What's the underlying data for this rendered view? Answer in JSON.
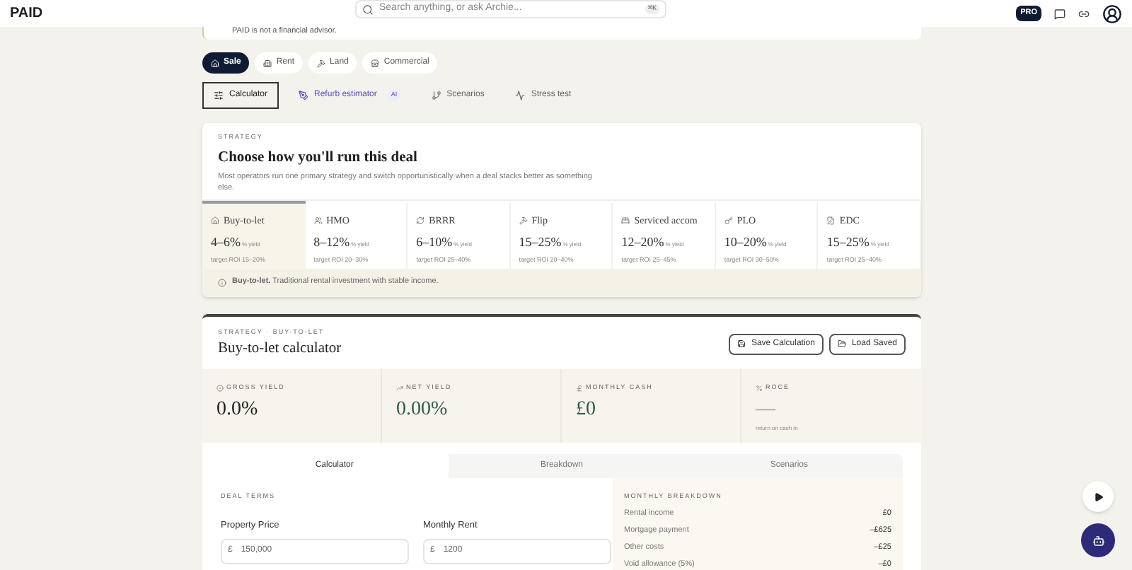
{
  "header": {
    "logo": "PAID",
    "search": {
      "placeholder": "Search anything, or ask Archie...",
      "shortcut": "⌘K"
    },
    "plan_badge": "PRO"
  },
  "notice": "PAID is not a financial advisor.",
  "property_types": [
    {
      "label": "Sale",
      "selected": true
    },
    {
      "label": "Rent",
      "selected": false
    },
    {
      "label": "Land",
      "selected": false
    },
    {
      "label": "Commercial",
      "selected": false
    }
  ],
  "tools": [
    {
      "label": "Calculator",
      "selected": true
    },
    {
      "label": "Refurb estimator",
      "badge": "AI",
      "selected": false
    },
    {
      "label": "Scenarios",
      "selected": false
    },
    {
      "label": "Stress test",
      "selected": false
    }
  ],
  "strategy": {
    "eyebrow": "STRATEGY",
    "title": "Choose how you'll run this deal",
    "description": "Most operators run one primary strategy and switch opportunistically when a deal stacks better as something else.",
    "options": [
      {
        "name": "Buy-to-let",
        "range": "4–6%",
        "unit": "% yield",
        "target": "target ROI 15–20%",
        "selected": true
      },
      {
        "name": "HMO",
        "range": "8–12%",
        "unit": "% yield",
        "target": "target ROI 20–30%",
        "selected": false
      },
      {
        "name": "BRRR",
        "range": "6–10%",
        "unit": "% yield",
        "target": "target ROI 25–40%",
        "selected": false
      },
      {
        "name": "Flip",
        "range": "15–25%",
        "unit": "% yield",
        "target": "target ROI 20–40%",
        "selected": false
      },
      {
        "name": "Serviced accom",
        "range": "12–20%",
        "unit": "% yield",
        "target": "target ROI 25–45%",
        "selected": false
      },
      {
        "name": "PLO",
        "range": "10–20%",
        "unit": "% yield",
        "target": "target ROI 30–50%",
        "selected": false
      },
      {
        "name": "EDC",
        "range": "15–25%",
        "unit": "% yield",
        "target": "target ROI 25–40%",
        "selected": false
      }
    ],
    "info": "**Buy-to-let.** Traditional rental investment with stable income."
  },
  "calculator": {
    "eyebrow": "STRATEGY · BUY-TO-LET",
    "title": "Buy-to-let calculator",
    "buttons": [
      "Save Calculation",
      "Load Saved"
    ],
    "stats": [
      {
        "label": "GROSS YIELD",
        "value": "0.0%",
        "color": "#1f1f1f"
      },
      {
        "label": "NET YIELD",
        "value": "0.00%",
        "color": "#2f5d4a"
      },
      {
        "label": "MONTHLY CASH",
        "value": "£0",
        "color": "#2f5d4a"
      },
      {
        "label": "ROCE",
        "value": "—",
        "note": "return on cash in",
        "color": "#9a9a9a"
      }
    ],
    "tabs": [
      {
        "label": "Calculator",
        "selected": true
      },
      {
        "label": "Breakdown",
        "selected": false
      },
      {
        "label": "Scenarios",
        "selected": false
      }
    ],
    "deal_terms": {
      "heading": "DEAL TERMS",
      "fields": [
        {
          "label": "Property Price",
          "prefix": "£",
          "value": "150,000"
        },
        {
          "label": "Monthly Rent",
          "prefix": "£",
          "value": "1200"
        }
      ]
    },
    "monthly_breakdown": {
      "heading": "MONTHLY BREAKDOWN",
      "rows": [
        {
          "label": "Rental income",
          "value": "£0"
        },
        {
          "label": "Mortgage payment",
          "value": "–£625"
        },
        {
          "label": "Other costs",
          "value": "–£25"
        },
        {
          "label": "Void allowance (5%)",
          "value": "–£0"
        }
      ]
    }
  }
}
